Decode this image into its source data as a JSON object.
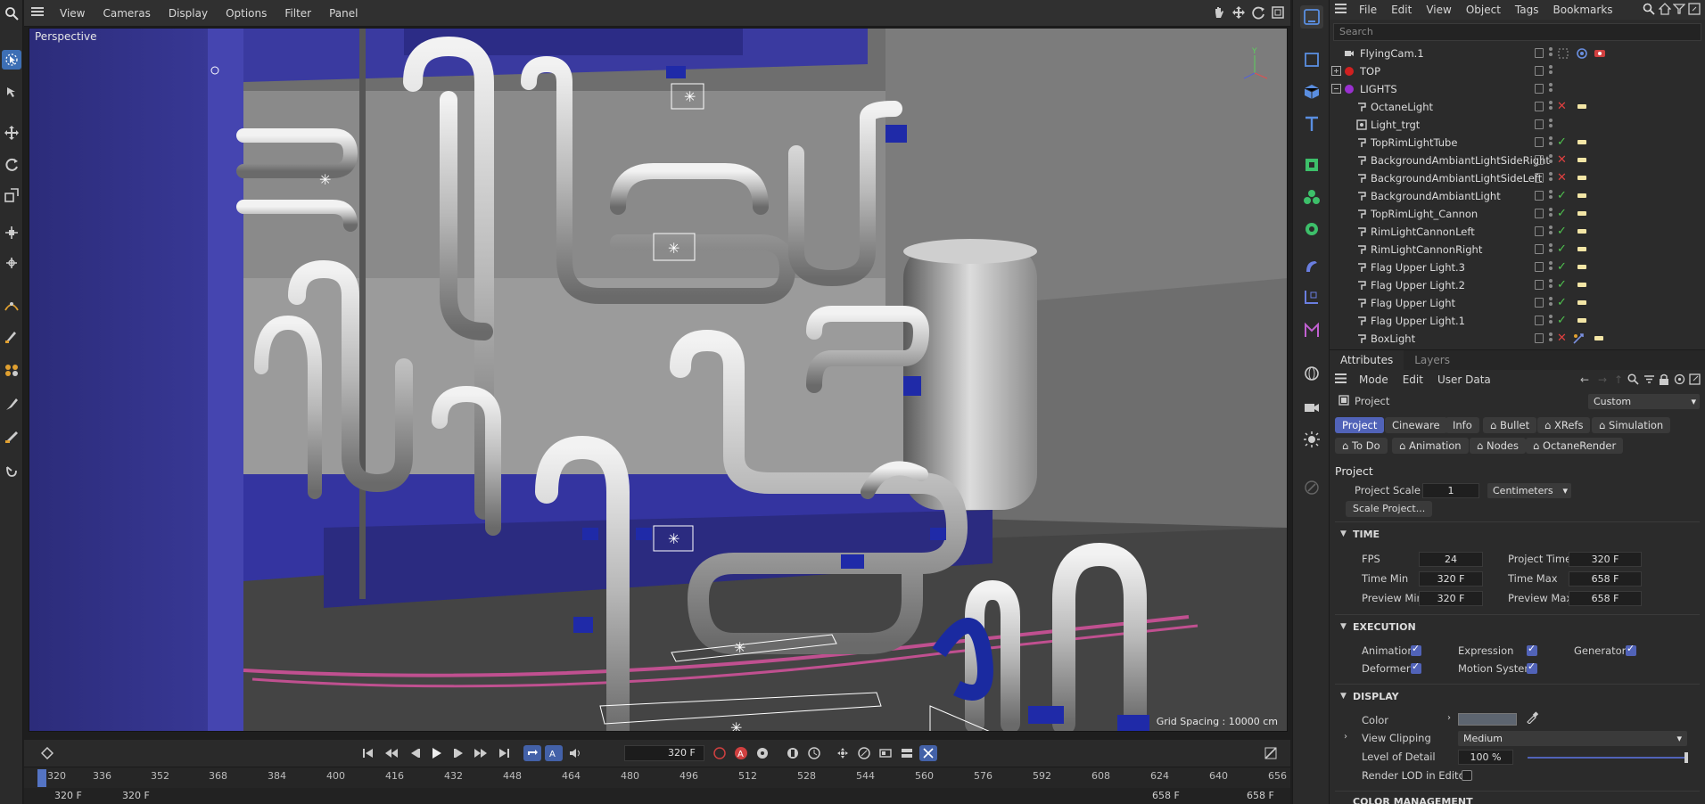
{
  "viewport_menu": {
    "items": [
      "View",
      "Cameras",
      "Display",
      "Options",
      "Filter",
      "Panel"
    ]
  },
  "viewport": {
    "label": "Perspective",
    "grid_spacing": "Grid Spacing : 10000 cm"
  },
  "transport": {
    "current_frame": "320 F"
  },
  "timeline": {
    "ticks": [
      "320",
      "336",
      "352",
      "368",
      "384",
      "400",
      "416",
      "432",
      "448",
      "464",
      "480",
      "496",
      "512",
      "528",
      "544",
      "560",
      "576",
      "592",
      "608",
      "624",
      "640",
      "656"
    ],
    "range_start": "320 F",
    "range_start2": "320 F",
    "range_end": "658 F",
    "range_end2": "658 F"
  },
  "object_manager": {
    "menu": [
      "File",
      "Edit",
      "View",
      "Object",
      "Tags",
      "Bookmarks"
    ],
    "search_placeholder": "Search",
    "objects": [
      {
        "name": "FlyingCam.1",
        "indent": 0,
        "status": ""
      },
      {
        "name": "TOP",
        "indent": 0,
        "status": ""
      },
      {
        "name": "LIGHTS",
        "indent": 0,
        "status": ""
      },
      {
        "name": "OctaneLight",
        "indent": 1,
        "status": "x"
      },
      {
        "name": "Light_trgt",
        "indent": 1,
        "status": ""
      },
      {
        "name": "TopRimLightTube",
        "indent": 1,
        "status": "check"
      },
      {
        "name": "BackgroundAmbiantLightSideRight",
        "indent": 1,
        "status": "x"
      },
      {
        "name": "BackgroundAmbiantLightSideLeft",
        "indent": 1,
        "status": "x"
      },
      {
        "name": "BackgroundAmbiantLight",
        "indent": 1,
        "status": "check"
      },
      {
        "name": "TopRimLight_Cannon",
        "indent": 1,
        "status": "check"
      },
      {
        "name": "RimLightCannonLeft",
        "indent": 1,
        "status": "check"
      },
      {
        "name": "RimLightCannonRight",
        "indent": 1,
        "status": "check"
      },
      {
        "name": "Flag Upper Light.3",
        "indent": 1,
        "status": "check"
      },
      {
        "name": "Flag Upper Light.2",
        "indent": 1,
        "status": "check"
      },
      {
        "name": "Flag Upper Light",
        "indent": 1,
        "status": "check"
      },
      {
        "name": "Flag Upper Light.1",
        "indent": 1,
        "status": "check"
      },
      {
        "name": "BoxLight",
        "indent": 1,
        "status": "x"
      }
    ]
  },
  "attributes": {
    "tabs": [
      "Attributes",
      "Layers"
    ],
    "menu": [
      "Mode",
      "Edit",
      "User Data"
    ],
    "context": "Project",
    "preset": "Custom",
    "pills_row1": [
      "Project",
      "Cineware",
      "Info",
      "Bullet",
      "XRefs",
      "Simulation"
    ],
    "pills_row2": [
      "To Do",
      "Animation",
      "Nodes",
      "OctaneRender"
    ],
    "section_title": "Project",
    "project_scale_label": "Project Scale",
    "project_scale_value": "1",
    "project_scale_unit": "Centimeters",
    "scale_project_button": "Scale Project...",
    "time": {
      "heading": "TIME",
      "fps_label": "FPS",
      "fps": "24",
      "project_time_label": "Project Time",
      "project_time": "320 F",
      "time_min_label": "Time Min",
      "time_min": "320 F",
      "time_max_label": "Time Max",
      "time_max": "658 F",
      "preview_min_label": "Preview Min",
      "preview_min": "320 F",
      "preview_max_label": "Preview Max",
      "preview_max": "658 F"
    },
    "execution": {
      "heading": "EXECUTION",
      "animation": "Animation",
      "expression": "Expression",
      "generators": "Generators",
      "deformers": "Deformers",
      "motion_system": "Motion System"
    },
    "display": {
      "heading": "DISPLAY",
      "color_label": "Color",
      "view_clipping_label": "View Clipping",
      "view_clipping": "Medium",
      "lod_label": "Level of Detail",
      "lod": "100 %",
      "render_lod_label": "Render LOD in Editor"
    },
    "next_heading": "COLOR MANAGEMENT"
  },
  "colors": {
    "accent": "#5163b8",
    "check": "#4fc34f",
    "cross": "#e04040"
  }
}
